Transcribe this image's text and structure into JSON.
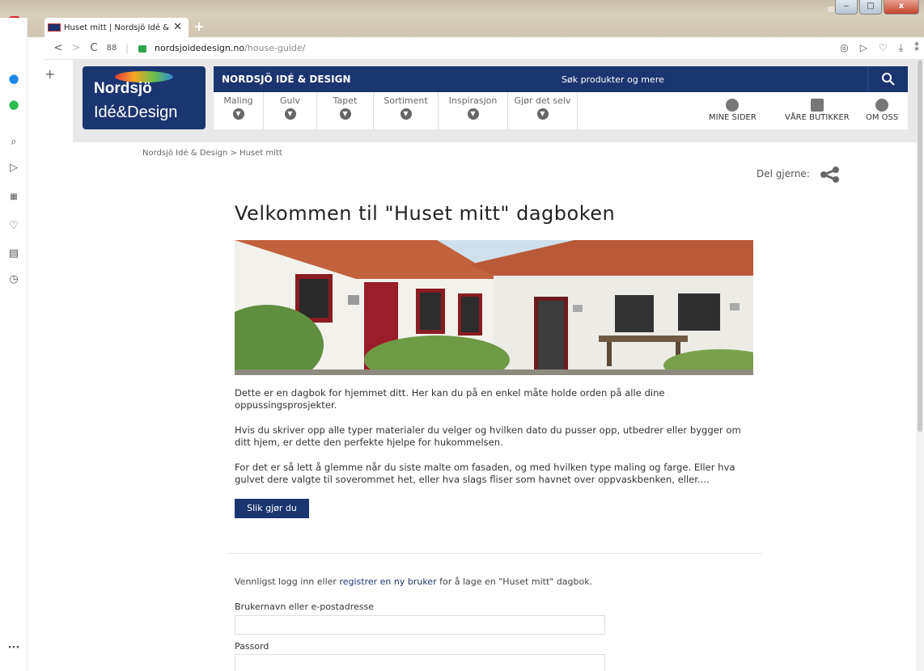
{
  "browser": {
    "tab_title": "Huset mitt | Nordsjö Idé &",
    "url_domain": "nordsjoidedesign.no",
    "url_path": "/house-guide/",
    "grid_button": "88"
  },
  "site": {
    "logo_brand": "Nordsjö",
    "logo_sub": "Idé&Design",
    "header_title": "NORDSJÖ IDÉ & DESIGN",
    "search_placeholder": "Søk produkter og mere",
    "menu": [
      "Maling",
      "Gulv",
      "Tapet",
      "Sortiment",
      "Inspirasjon",
      "Gjør det selv"
    ],
    "right_links": [
      "MINE SIDER",
      "VÅRE BUTIKKER",
      "OM OSS"
    ],
    "brand_color": "#1b3570"
  },
  "breadcrumb": {
    "home": "Nordsjö Idé & Design",
    "current": "> Huset mitt"
  },
  "share_label": "Del gjerne:",
  "content": {
    "title": "Velkommen til \"Huset mitt\" dagboken",
    "para1": "Dette er en dagbok for hjemmet ditt. Her kan du på en enkel måte holde orden på alle dine oppussingsprosjekter.",
    "para2": "Hvis du skriver opp alle typer materialer du velger og hvilken dato du pusser opp, utbedrer eller bygger om ditt hjem, er dette den perfekte hjelpe for hukommelsen.",
    "para3": "For det er så lett å glemme når du siste malte om fasaden, og med hvilken type maling og farge. Eller hva gulvet dere valgte til soverommet het, eller hva slags fliser som havnet over oppvaskbenken, eller....",
    "button": "Slik gjør du"
  },
  "login": {
    "note_before": "Vennligst logg inn eller ",
    "note_link": "registrer en ny bruker",
    "note_after": " for å lage en \"Huset mitt\" dagbok.",
    "username_label": "Brukernavn eller e-postadresse",
    "password_label": "Passord"
  }
}
